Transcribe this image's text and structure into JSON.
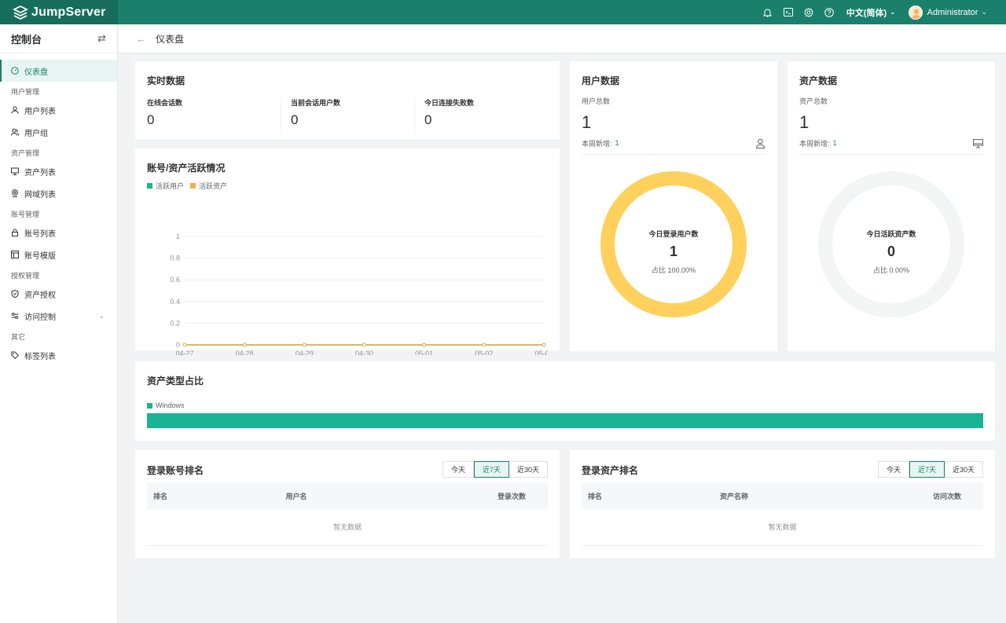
{
  "app": {
    "brand_name": "JumpServer",
    "language": "中文(简体)",
    "username": "Administrator",
    "accent_color": "#1a806b",
    "header_icons": [
      "bell-icon",
      "terminal-icon",
      "settings-icon",
      "help-icon"
    ]
  },
  "sidebar": {
    "title": "控制台",
    "items": [
      {
        "label": "仪表盘",
        "icon": "dashboard-icon",
        "active": true
      },
      {
        "group": "用户管理"
      },
      {
        "label": "用户列表",
        "icon": "user-icon"
      },
      {
        "label": "用户组",
        "icon": "user-group-icon"
      },
      {
        "group": "资产管理"
      },
      {
        "label": "资产列表",
        "icon": "monitor-icon"
      },
      {
        "label": "网域列表",
        "icon": "pin-icon"
      },
      {
        "group": "账号管理"
      },
      {
        "label": "账号列表",
        "icon": "lock-icon"
      },
      {
        "label": "账号模版",
        "icon": "template-icon"
      },
      {
        "group": "授权管理"
      },
      {
        "label": "资产授权",
        "icon": "shield-icon"
      },
      {
        "label": "访问控制",
        "icon": "control-icon",
        "expandable": true
      },
      {
        "group": "其它"
      },
      {
        "label": "标签列表",
        "icon": "tag-icon"
      }
    ]
  },
  "page": {
    "title": "仪表盘"
  },
  "realtime": {
    "title": "实时数据",
    "stats": [
      {
        "label": "在线会话数",
        "value": "0"
      },
      {
        "label": "当前会话用户数",
        "value": "0"
      },
      {
        "label": "今日连接失败数",
        "value": "0"
      }
    ]
  },
  "activity": {
    "title": "账号/资产活跃情况",
    "legend": [
      {
        "label": "活跃用户",
        "color": "#1ab394"
      },
      {
        "label": "活跃资产",
        "color": "#f0ad4e"
      }
    ]
  },
  "chart_data": {
    "type": "line",
    "x": [
      "04-27",
      "04-28",
      "04-29",
      "04-30",
      "05-01",
      "05-02",
      "05-03"
    ],
    "series": [
      {
        "name": "活跃用户",
        "values": [
          0,
          0,
          0,
          0,
          0,
          0,
          0
        ],
        "color": "#1ab394"
      },
      {
        "name": "活跃资产",
        "values": [
          0,
          0,
          0,
          0,
          0,
          0,
          0
        ],
        "color": "#f0ad4e"
      }
    ],
    "ylim": [
      0,
      1
    ],
    "yticks": [
      "0",
      "0.2",
      "0.4",
      "0.6",
      "0.8",
      "1"
    ],
    "grid": true,
    "legend": "top-left"
  },
  "user_data": {
    "title": "用户数据",
    "total_label": "用户总数",
    "total": "1",
    "week_label": "本周新增:",
    "week_value": "1",
    "ring_title": "今日登录用户数",
    "ring_value": "1",
    "ring_pct": "占比 100.00%",
    "ring_ratio": 1.0,
    "ring_color": "#ffd05b"
  },
  "asset_data": {
    "title": "资产数据",
    "total_label": "资产总数",
    "total": "1",
    "week_label": "本周新增:",
    "week_value": "1",
    "ring_title": "今日活跃资产数",
    "ring_value": "0",
    "ring_pct": "占比 0.00%",
    "ring_ratio": 0.0,
    "ring_color": "#f2f5f4"
  },
  "asset_types": {
    "title": "资产类型占比",
    "items": [
      {
        "label": "Windows",
        "ratio": 1.0,
        "color": "#1ab394"
      }
    ]
  },
  "login_account_rank": {
    "title": "登录账号排名",
    "tabs": [
      "今天",
      "近7天",
      "近30天"
    ],
    "active_tab": "近7天",
    "columns": [
      "排名",
      "用户名",
      "登录次数"
    ],
    "empty_text": "暂无数据"
  },
  "login_asset_rank": {
    "title": "登录资产排名",
    "tabs": [
      "今天",
      "近7天",
      "近30天"
    ],
    "active_tab": "近7天",
    "columns": [
      "排名",
      "资产名称",
      "访问次数"
    ],
    "empty_text": "暂无数据"
  }
}
